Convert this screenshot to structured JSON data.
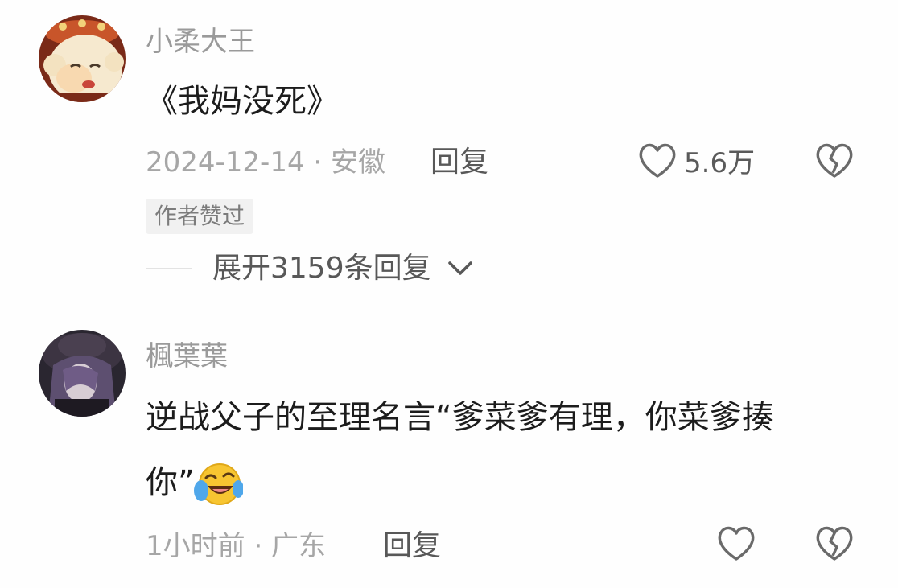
{
  "comments": [
    {
      "username": "小柔大王",
      "text": "《我妈没死》",
      "meta": "2024-12-14 · 安徽",
      "reply_label": "回复",
      "like_count": "5.6万",
      "badge": "作者赞过",
      "expand_label": "展开3159条回复"
    },
    {
      "username": "楓葉葉",
      "text_line1": "逆战父子的至理名言“爹菜爹有理，你菜爹揍",
      "text_line2": "你”",
      "emoji": "laughing-crying-emoji",
      "meta": "1小时前 · 广东",
      "reply_label": "回复"
    }
  ],
  "icons": {
    "like": "heart-outline-icon",
    "dislike": "broken-heart-icon",
    "expand": "chevron-down-icon"
  },
  "colors": {
    "username": "#9a9a9a",
    "meta": "#a6a6a6",
    "text": "#1c1c1c",
    "action": "#585858"
  }
}
